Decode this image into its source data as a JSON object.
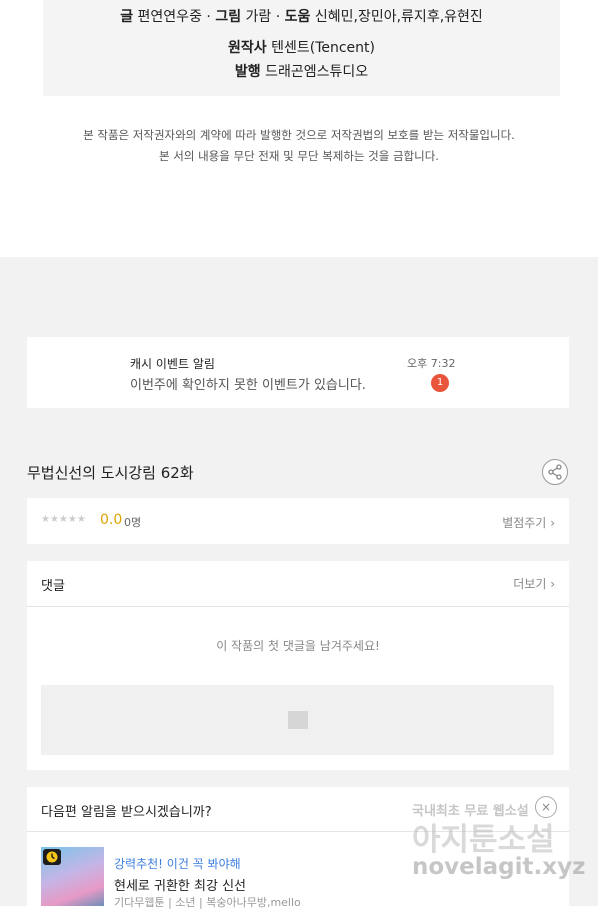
{
  "credits": {
    "line1": [
      {
        "k": "글",
        "v": "편연연우중"
      },
      {
        "k": "그림",
        "v": "가람"
      },
      {
        "k": "도움",
        "v": "신혜민,장민아,류지후,유현진"
      }
    ],
    "original_label": "원작사",
    "original_value": "텐센트(Tencent)",
    "publisher_label": "발행",
    "publisher_value": "드래곤엠스튜디오"
  },
  "notice": {
    "line1": "본 작품은 저작권자와의 계약에 따라 발행한 것으로 저작권법의 보호를 받는 저작물입니다.",
    "line2": "본 서의 내용을 무단 전재 및 무단 복제하는 것을 금합니다."
  },
  "event": {
    "title": "캐시 이벤트 알림",
    "message": "이번주에 확인하지 못한 이벤트가 있습니다.",
    "time": "오후 7:32",
    "badge": "1"
  },
  "episode": {
    "title": "무법신선의 도시강림 62화"
  },
  "rating": {
    "stars": "★★★★★",
    "score": "0.0",
    "count": "0명",
    "link": "별점주기"
  },
  "comments": {
    "heading": "댓글",
    "more": "더보기",
    "empty": "이 작품의 첫 댓글을 남겨주세요!"
  },
  "next": {
    "question": "다음편 알림을 받으시겠습니까?",
    "close": "×",
    "recommend": "강력추천! 이건 꼭 봐야해",
    "work_title": "현세로 귀환한 최강 신선",
    "meta": "기다무웹툰 | 소년 | 복숭아나무방,mello"
  },
  "watermark": {
    "line1": "국내최초 무료 웹소설",
    "line2": "아지툰소설",
    "line3": "novelagit.xyz"
  },
  "colors": {
    "accent": "#3c7fe0",
    "badge": "#e8553c",
    "score": "#e0a400"
  }
}
